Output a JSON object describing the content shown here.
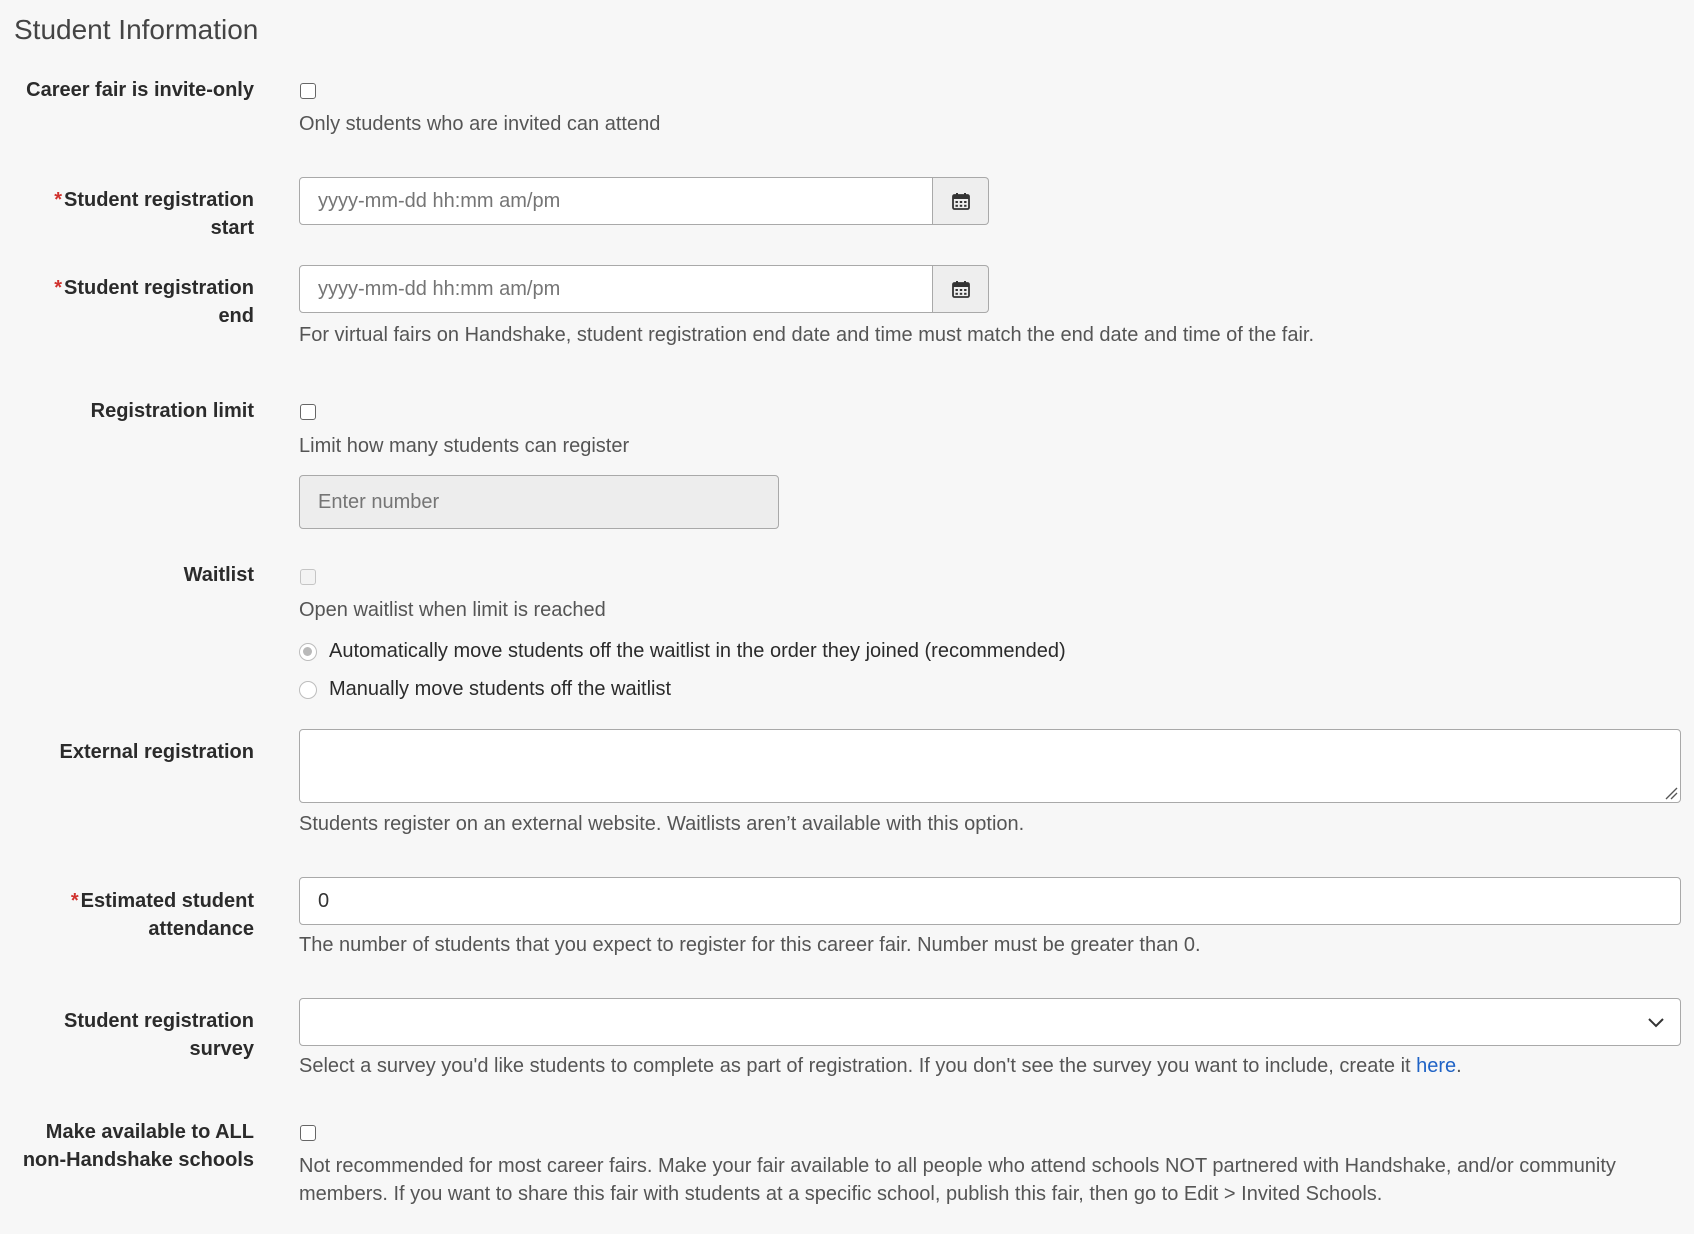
{
  "section": {
    "title": "Student Information"
  },
  "invite_only": {
    "label": "Career fair is invite-only",
    "help": "Only students who are invited can attend"
  },
  "reg_start": {
    "required_mark": "*",
    "label_line1": "Student registration",
    "label_line2": "start",
    "placeholder": "yyyy-mm-dd hh:mm am/pm",
    "icon": "calendar-icon"
  },
  "reg_end": {
    "required_mark": "*",
    "label_line1": "Student registration",
    "label_line2": "end",
    "placeholder": "yyyy-mm-dd hh:mm am/pm",
    "icon": "calendar-icon",
    "help": "For virtual fairs on Handshake, student registration end date and time must match the end date and time of the fair."
  },
  "reg_limit": {
    "label": "Registration limit",
    "help": "Limit how many students can register",
    "placeholder": "Enter number"
  },
  "waitlist": {
    "label": "Waitlist",
    "help": "Open waitlist when limit is reached",
    "options": [
      {
        "label": "Automatically move students off the waitlist in the order they joined (recommended)",
        "selected": true
      },
      {
        "label": "Manually move students off the waitlist",
        "selected": false
      }
    ]
  },
  "external_reg": {
    "label": "External registration",
    "value": "",
    "help": "Students register on an external website. Waitlists aren’t available with this option."
  },
  "attendance": {
    "required_mark": "*",
    "label_line1": "Estimated student",
    "label_line2": "attendance",
    "value": "0",
    "help": "The number of students that you expect to register for this career fair. Number must be greater than 0."
  },
  "survey": {
    "label_line1": "Student registration",
    "label_line2": "survey",
    "selected": "",
    "help_prefix": "Select a survey you'd like students to complete as part of registration. If you don't see the survey you want to include, create it ",
    "help_link": "here",
    "help_suffix": ".",
    "icon": "chevron-down-icon"
  },
  "non_handshake": {
    "label_line1": "Make available to ALL",
    "label_line2": "non-Handshake schools",
    "help_line1": "Not recommended for most career fairs. Make your fair available to all people who attend schools NOT partnered with Handshake, and/or community",
    "help_line2": "members. If you want to share this fair with students at a specific school, publish this fair, then go to Edit > Invited Schools."
  },
  "colors": {
    "required": "#d0312d",
    "link": "#1f63c6",
    "background": "#f7f7f7"
  }
}
